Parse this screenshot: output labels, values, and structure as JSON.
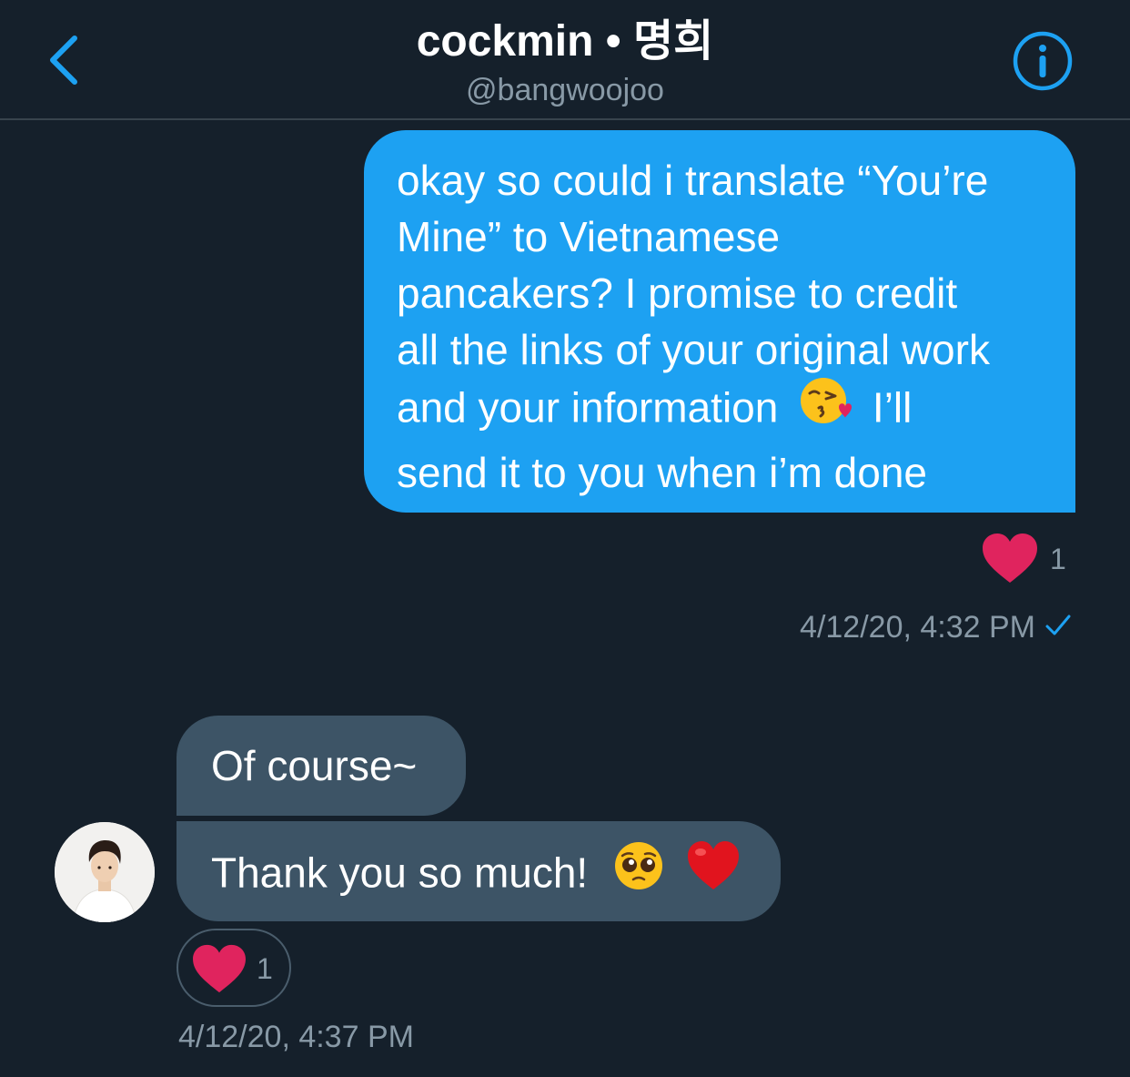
{
  "header": {
    "title": "cockmin • 명희",
    "handle": "@bangwoojoo",
    "back_icon": "chevron-left-icon",
    "info_icon": "info-icon"
  },
  "colors": {
    "background": "#15202b",
    "accent": "#1da1f2",
    "incoming_bubble": "#3d5466",
    "muted_text": "#8899a6",
    "heart": "#e0245e"
  },
  "messages": [
    {
      "direction": "outgoing",
      "lines": [
        "okay so could i translate “You’re",
        "Mine” to Vietnamese",
        "pancakers? I promise to credit",
        "all the links of your original work",
        "and your information",
        "I’ll",
        "send it to you when i’m done"
      ],
      "emoji": "kissing-heart-emoji",
      "reaction": {
        "icon": "heart-icon",
        "count": "1"
      },
      "timestamp": "4/12/20, 4:32 PM",
      "status_icon": "checkmark-icon"
    },
    {
      "direction": "incoming",
      "text": "Of course~"
    },
    {
      "direction": "incoming",
      "text": "Thank you so much!",
      "emojis": [
        "pleading-face-emoji",
        "red-heart-emoji"
      ],
      "reaction": {
        "icon": "heart-icon",
        "count": "1"
      },
      "timestamp": "4/12/20, 4:37 PM",
      "avatar": "avatar"
    }
  ]
}
